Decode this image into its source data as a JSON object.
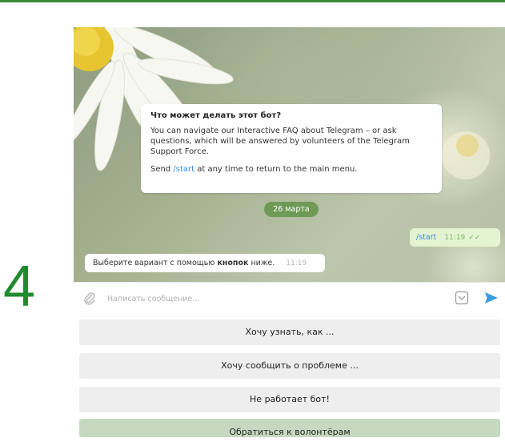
{
  "step_number": "4",
  "chat": {
    "info": {
      "title": "Что может делать этот бот?",
      "body": "You can navigate our Interactive FAQ about Telegram – or ask questions, which will be answered by volunteers of the Telegram Support Force.",
      "send_prefix": "Send ",
      "send_link": "/start",
      "send_suffix": " at any time to return to the main menu."
    },
    "date_label": "26 марта",
    "outgoing": {
      "text": "/start",
      "time": "11:19",
      "ticks": "✓✓"
    },
    "incoming": {
      "text_before": "Выберите вариант с помощью ",
      "text_bold": "кнопок",
      "text_after": " ниже.",
      "time": "11:19"
    }
  },
  "composer": {
    "placeholder": "Написать сообщение...",
    "icons": [
      "paperclip-icon",
      "keyboard-icon",
      "send-icon"
    ]
  },
  "keyboard": {
    "buttons": [
      "Хочу узнать, как ...",
      "Хочу сообщить о проблеме ...",
      "Не работает бот!",
      "Обратиться к волонтёрам"
    ]
  },
  "colors": {
    "accent_green": "#1f8a2e",
    "link_blue": "#3a8ed6",
    "send_blue": "#3a9ee0",
    "date_pill": "#6f9a56",
    "outgoing_bubble": "#e4f4d2"
  }
}
